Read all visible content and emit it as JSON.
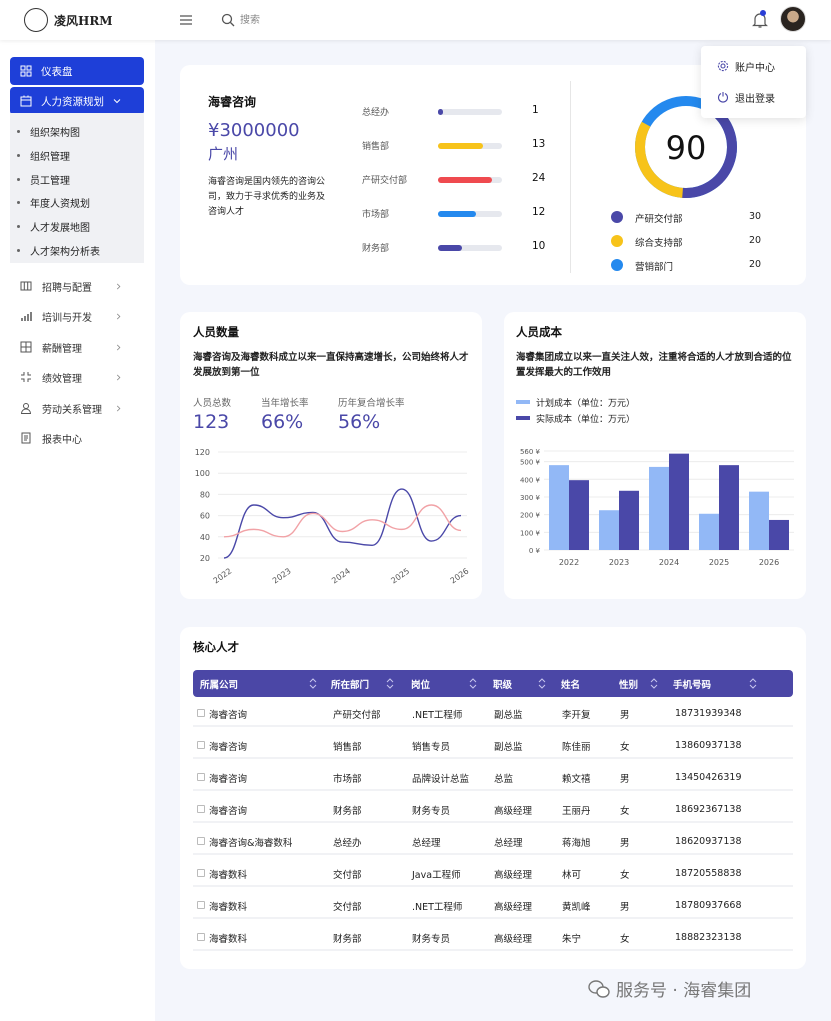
{
  "app": {
    "title": "凌风HRM"
  },
  "header": {
    "search_placeholder": "搜索"
  },
  "user_menu": {
    "items": [
      "账户中心",
      "退出登录"
    ]
  },
  "sidebar": {
    "dashboard": "仪表盘",
    "hr_planning": "人力资源规划",
    "hr_sub": [
      "组织架构图",
      "组织管理",
      "员工管理",
      "年度人资规划",
      "人才发展地图",
      "人才架构分析表"
    ],
    "items": [
      "招聘与配置",
      "培训与开发",
      "薪酬管理",
      "绩效管理",
      "劳动关系管理",
      "报表中心"
    ]
  },
  "company": {
    "name": "海睿咨询",
    "capital": "¥3000000",
    "city": "广州",
    "description": "海睿咨询是国内领先的咨询公司，致力于寻求优秀的业务及咨询人才",
    "departments": [
      {
        "name": "总经办",
        "value": "1",
        "color": "#4a48a8",
        "fill": 0.08
      },
      {
        "name": "销售部",
        "value": "13",
        "color": "#f7c31a",
        "fill": 0.7
      },
      {
        "name": "产研交付部",
        "value": "24",
        "color": "#ef4a4f",
        "fill": 0.85
      },
      {
        "name": "市场部",
        "value": "12",
        "color": "#2489ee",
        "fill": 0.6
      },
      {
        "name": "财务部",
        "value": "10",
        "color": "#4a48a8",
        "fill": 0.38
      }
    ],
    "score": "90",
    "legend": [
      {
        "name": "产研交付部",
        "value": "30",
        "color": "#4a48a8"
      },
      {
        "name": "综合支持部",
        "value": "20",
        "color": "#f7c31a"
      },
      {
        "name": "营销部门",
        "value": "20",
        "color": "#2489ee"
      }
    ]
  },
  "headcount": {
    "title": "人员数量",
    "description": "海睿咨询及海睿数科成立以来一直保持高速增长，公司始终将人才发展放到第一位",
    "stats": [
      {
        "label": "人员总数",
        "value": "123"
      },
      {
        "label": "当年增长率",
        "value": "66%"
      },
      {
        "label": "历年复合增长率",
        "value": "56%"
      }
    ]
  },
  "cost": {
    "title": "人员成本",
    "description": "海睿集团成立以来一直关注人效，注重将合适的人才放到合适的位置发挥最大的工作效用",
    "legend": [
      "计划成本（单位：万元）",
      "实际成本（单位：万元）"
    ]
  },
  "chart_data": [
    {
      "type": "line",
      "x": [
        "2022",
        "2023",
        "2024",
        "2025",
        "2026"
      ],
      "ylim": [
        20,
        120
      ],
      "yticks": [
        "120",
        "100",
        "80",
        "60",
        "40",
        "20"
      ],
      "colors": [
        "#4a48a8",
        "#f1a2a6"
      ],
      "series": [
        {
          "values": [
            20,
            70,
            58,
            63,
            35,
            32,
            85,
            36,
            60
          ]
        },
        {
          "values": [
            40,
            47,
            40,
            62,
            45,
            56,
            47,
            70,
            46
          ]
        }
      ]
    },
    {
      "type": "bar",
      "categories": [
        "2022",
        "2023",
        "2024",
        "2025",
        "2026"
      ],
      "ylim": [
        0,
        560
      ],
      "yticks": [
        "560 ¥",
        "500 ¥",
        "400 ¥",
        "300 ¥",
        "200 ¥",
        "100 ¥",
        "0 ¥"
      ],
      "colors": [
        "#92b8f6",
        "#4a48a8"
      ],
      "series": [
        {
          "name": "计划成本（单位：万元）",
          "values": [
            480,
            225,
            470,
            205,
            330
          ]
        },
        {
          "name": "实际成本（单位：万元）",
          "values": [
            395,
            335,
            545,
            480,
            170
          ]
        }
      ]
    }
  ],
  "talent": {
    "title": "核心人才",
    "columns": [
      "所属公司",
      "所在部门",
      "岗位",
      "职级",
      "姓名",
      "性别",
      "手机号码"
    ],
    "rows": [
      [
        "海睿咨询",
        "产研交付部",
        ".NET工程师",
        "副总监",
        "李开复",
        "男",
        "18731939348"
      ],
      [
        "海睿咨询",
        "销售部",
        "销售专员",
        "副总监",
        "陈佳丽",
        "女",
        "13860937138"
      ],
      [
        "海睿咨询",
        "市场部",
        "品牌设计总监",
        "总监",
        "赖文禧",
        "男",
        "13450426319"
      ],
      [
        "海睿咨询",
        "财务部",
        "财务专员",
        "高级经理",
        "王丽丹",
        "女",
        "18692367138"
      ],
      [
        "海睿咨询&海睿数科",
        "总经办",
        "总经理",
        "总经理",
        "蒋海旭",
        "男",
        "18620937138"
      ],
      [
        "海睿数科",
        "交付部",
        "Java工程师",
        "高级经理",
        "林可",
        "女",
        "18720558838"
      ],
      [
        "海睿数科",
        "交付部",
        ".NET工程师",
        "高级经理",
        "黄凯峰",
        "男",
        "18780937668"
      ],
      [
        "海睿数科",
        "财务部",
        "财务专员",
        "高级经理",
        "朱宁",
        "女",
        "18882323138"
      ]
    ]
  },
  "watermark": "服务号 · 海睿集团"
}
